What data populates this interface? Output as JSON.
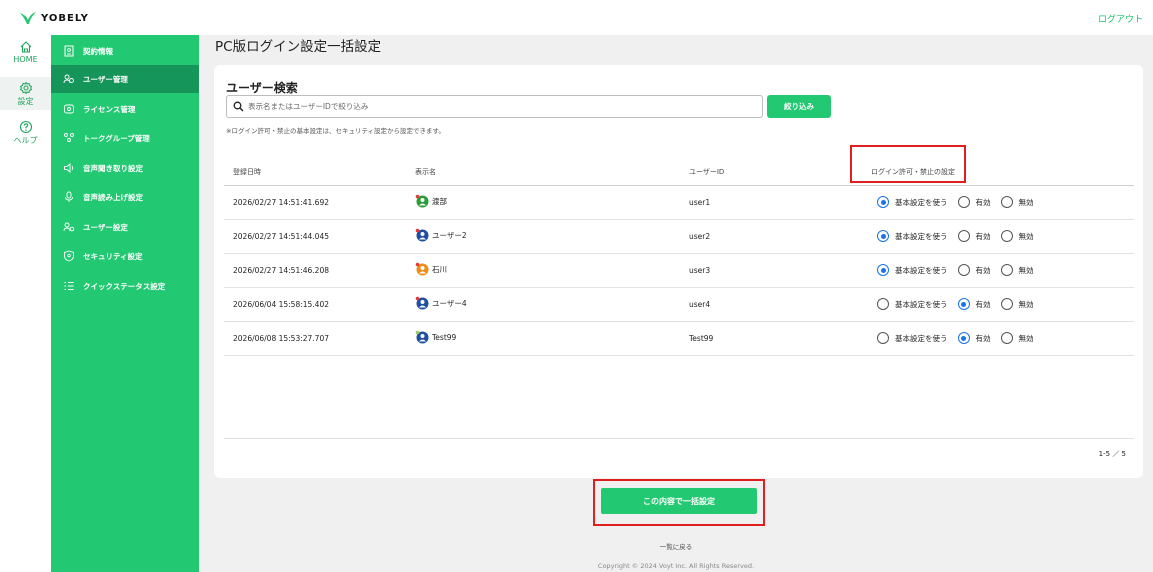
{
  "header": {
    "logo_text": "YOBELY",
    "logout_label": "ログアウト",
    "brand_color": "#22c872"
  },
  "rail": {
    "items": [
      {
        "label": "HOME",
        "icon": "home-icon"
      },
      {
        "label": "設定",
        "icon": "gear-icon"
      },
      {
        "label": "ヘルプ",
        "icon": "help-icon"
      }
    ]
  },
  "sidebar": {
    "items": [
      {
        "label": "契約情報",
        "icon": "contract-icon"
      },
      {
        "label": "ユーザー管理",
        "icon": "users-icon"
      },
      {
        "label": "ライセンス管理",
        "icon": "license-icon"
      },
      {
        "label": "トークグループ管理",
        "icon": "group-icon"
      },
      {
        "label": "音声聞き取り設定",
        "icon": "speaker-icon"
      },
      {
        "label": "音声読み上げ設定",
        "icon": "microphone-icon"
      },
      {
        "label": "ユーザー設定",
        "icon": "user-settings-icon"
      },
      {
        "label": "セキュリティ設定",
        "icon": "shield-icon"
      },
      {
        "label": "クイックステータス設定",
        "icon": "list-icon"
      }
    ]
  },
  "main": {
    "page_title": "PC版ログイン設定一括設定",
    "card_title": "ユーザー検索",
    "search": {
      "placeholder": "表示名またはユーザーIDで絞り込み",
      "value": ""
    },
    "filter_button": "絞り込み",
    "note": "※ログイン許可・禁止の基本設定は、セキュリティ設定から設定できます。",
    "table": {
      "headers": [
        "登録日時",
        "表示名",
        "ユーザーID",
        "ログイン許可・禁止の設定"
      ],
      "radio_labels": [
        "基本設定を使う",
        "有効",
        "無効"
      ],
      "rows": [
        {
          "date": "2026/02/27 14:51:41.692",
          "name": "渡部",
          "user_id": "user1",
          "selected": 0,
          "avatar_color": "#2a9d3a",
          "dot_color": "#e53935"
        },
        {
          "date": "2026/02/27 14:51:44.045",
          "name": "ユーザー2",
          "user_id": "user2",
          "selected": 0,
          "avatar_color": "#1f4fa0",
          "dot_color": "#e53935"
        },
        {
          "date": "2026/02/27 14:51:46.208",
          "name": "石川",
          "user_id": "user3",
          "selected": 0,
          "avatar_color": "#f08c1a",
          "dot_color": "#e53935"
        },
        {
          "date": "2026/06/04 15:58:15.402",
          "name": "ユーザー4",
          "user_id": "user4",
          "selected": 1,
          "avatar_color": "#1f4fa0",
          "dot_color": "#e53935"
        },
        {
          "date": "2026/06/08 15:53:27.707",
          "name": "Test99",
          "user_id": "Test99",
          "selected": 1,
          "avatar_color": "#1f4fa0",
          "dot_color": "#9ccc65"
        }
      ]
    },
    "pager": "1-5 ／ 5",
    "submit_button": "この内容で一括設定",
    "back_link": "一覧に戻る",
    "copyright": "Copyright © 2024 Voyt Inc. All Rights Reserved."
  }
}
